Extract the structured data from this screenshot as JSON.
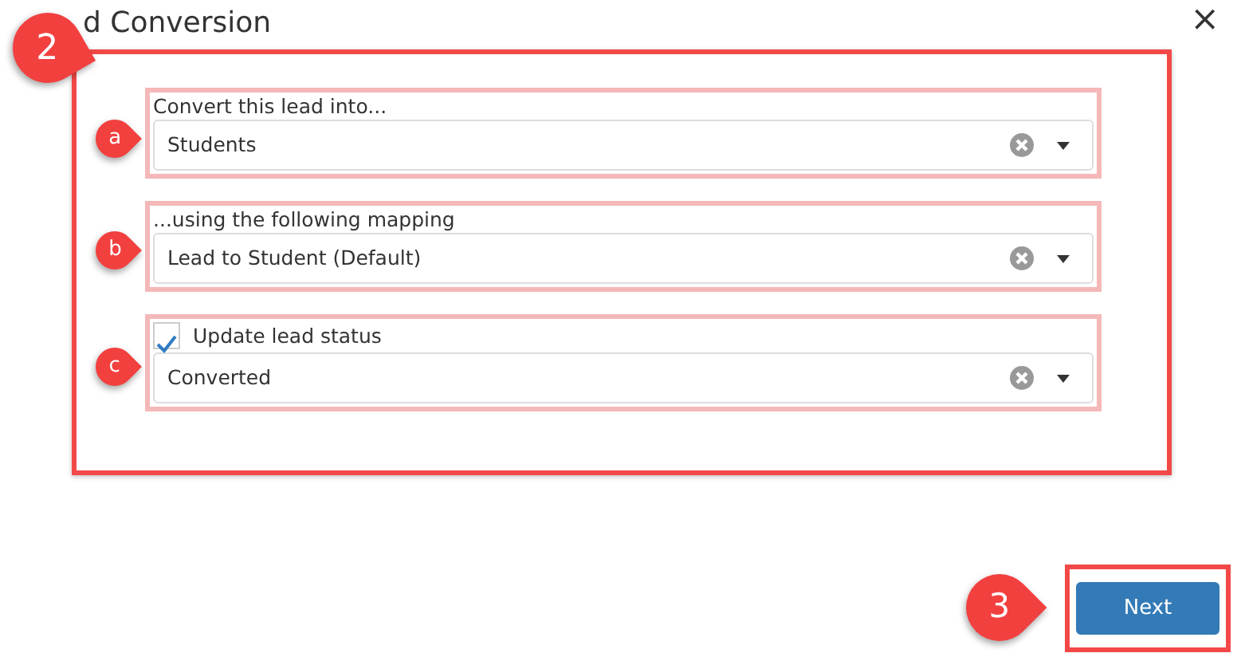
{
  "dialog": {
    "title": "d Conversion",
    "close": "×",
    "section_callout": "2"
  },
  "fields": [
    {
      "kind": "select",
      "callout": "a",
      "label": "Convert this lead into...",
      "value": "Students"
    },
    {
      "kind": "select",
      "callout": "b",
      "label": "...using the following mapping",
      "value": "Lead to Student (Default)"
    },
    {
      "kind": "checkbox_select",
      "callout": "c",
      "label": "Update lead status",
      "checked": true,
      "value": "Converted"
    }
  ],
  "footer": {
    "callout": "3",
    "button": "Next"
  }
}
